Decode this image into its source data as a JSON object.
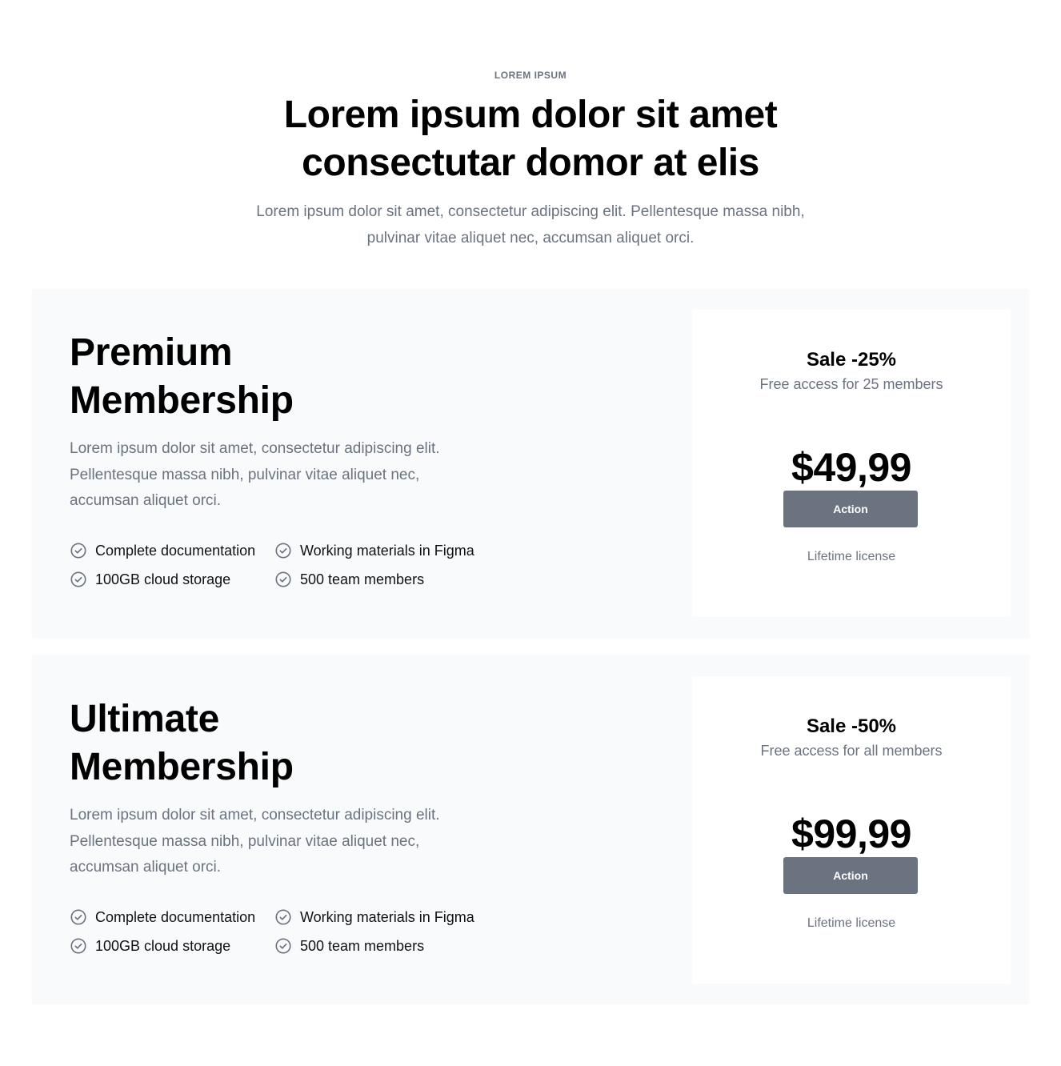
{
  "header": {
    "eyebrow": "LOREM IPSUM",
    "title_lines": [
      "Lorem ipsum dolor sit amet",
      "consectutar domor at elis"
    ],
    "subtitle_lines": [
      "Lorem ipsum dolor sit amet, consectetur adipiscing elit. Pellentesque massa nibh,",
      "pulvinar vitae aliquet nec, accumsan aliquet orci."
    ]
  },
  "plans": [
    {
      "name_lines": [
        "Premium",
        "Membership"
      ],
      "description": "Lorem ipsum dolor sit amet, consectetur adipiscing elit. Pellentesque massa nibh, pulvinar vitae aliquet nec, accumsan aliquet orci.",
      "features": [
        "Complete documentation",
        "Working materials in Figma",
        "100GB cloud storage",
        "500 team members"
      ],
      "sale": "Sale -25%",
      "access": "Free access for 25 members",
      "price": "$49,99",
      "action_label": "Action",
      "license": "Lifetime license"
    },
    {
      "name_lines": [
        "Ultimate",
        "Membership"
      ],
      "description": "Lorem ipsum dolor sit amet, consectetur adipiscing elit. Pellentesque massa nibh, pulvinar vitae aliquet nec, accumsan aliquet orci.",
      "features": [
        "Complete documentation",
        "Working materials in Figma",
        "100GB cloud storage",
        "500 team members"
      ],
      "sale": "Sale -50%",
      "access": "Free access for all members",
      "price": "$99,99",
      "action_label": "Action",
      "license": "Lifetime license"
    }
  ],
  "icons": {
    "feature_icon": "check-circle-icon"
  },
  "colors": {
    "button_bg": "#6b7280",
    "muted_text": "#6b7280",
    "card_bg": "#f9fafb"
  }
}
